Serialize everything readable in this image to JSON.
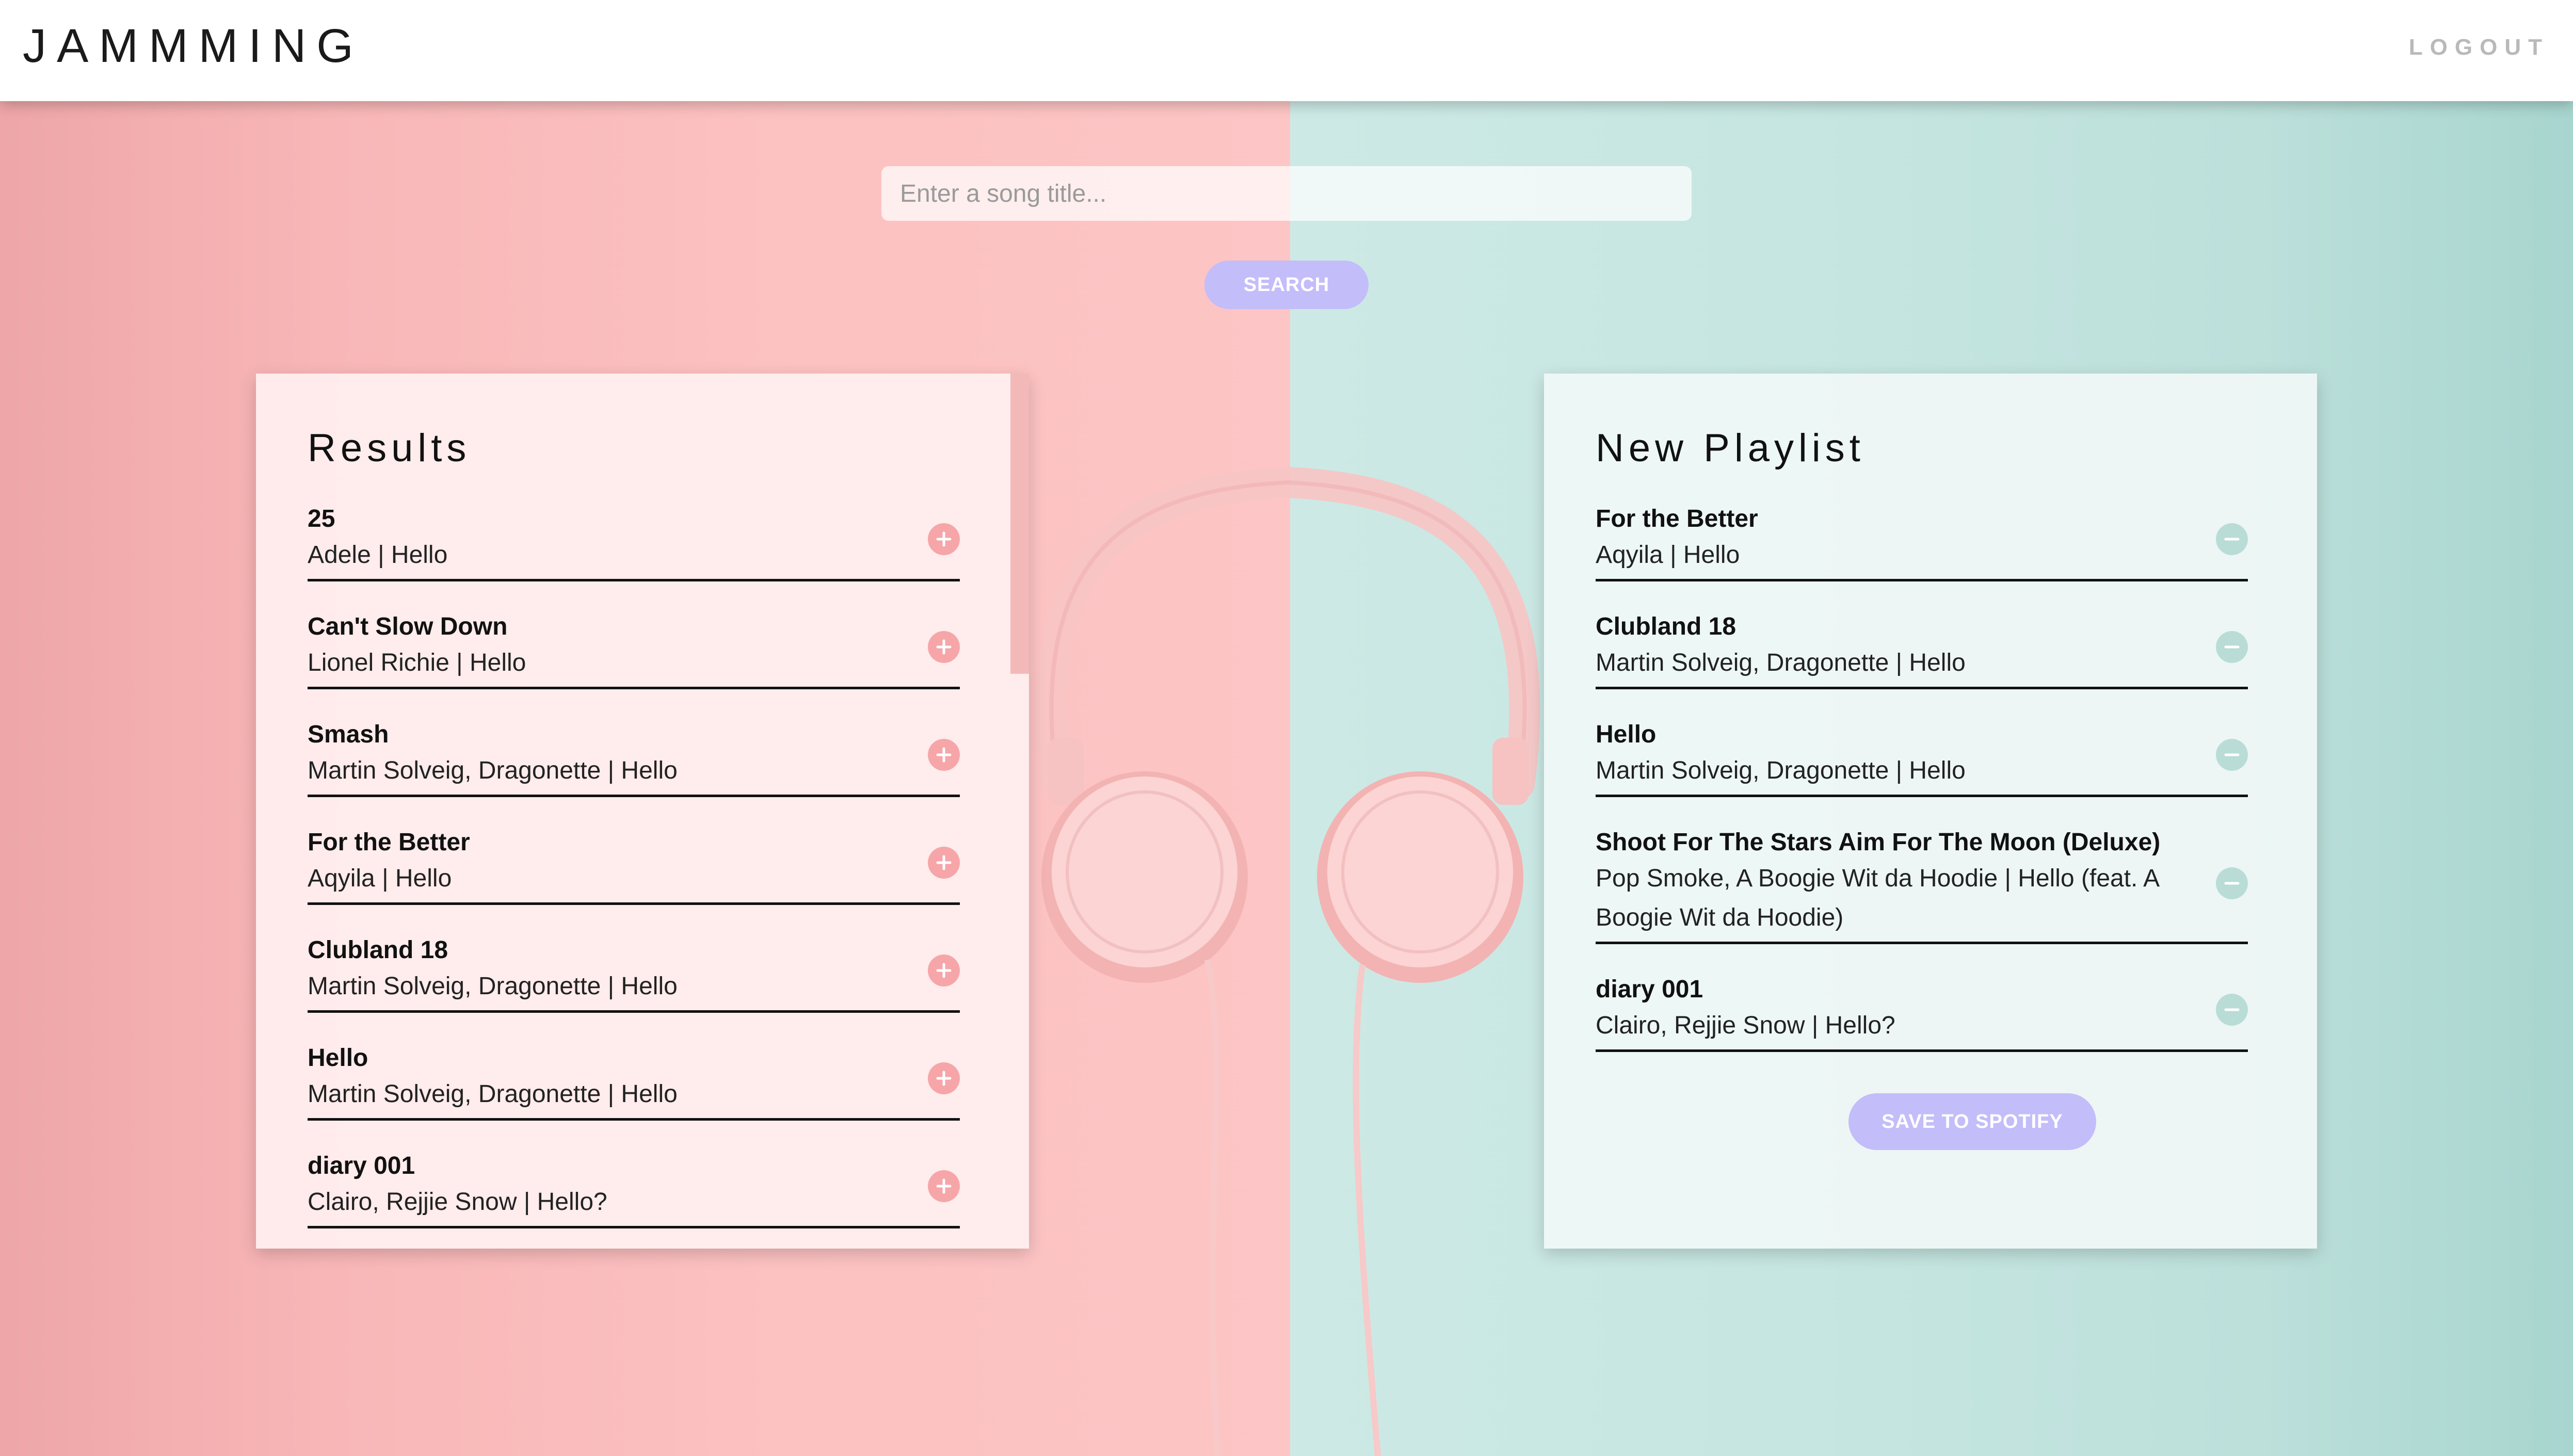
{
  "header": {
    "logo": "JAMMMING",
    "logout": "LOGOUT"
  },
  "search": {
    "placeholder": "Enter a song title...",
    "button": "SEARCH"
  },
  "results": {
    "title": "Results",
    "tracks": [
      {
        "name": "25",
        "info": "Adele | Hello"
      },
      {
        "name": "Can't Slow Down",
        "info": "Lionel Richie | Hello"
      },
      {
        "name": "Smash",
        "info": "Martin Solveig, Dragonette | Hello"
      },
      {
        "name": "For the Better",
        "info": "Aqyila | Hello"
      },
      {
        "name": "Clubland 18",
        "info": "Martin Solveig, Dragonette | Hello"
      },
      {
        "name": "Hello",
        "info": "Martin Solveig, Dragonette | Hello"
      },
      {
        "name": "diary 001",
        "info": "Clairo, Rejjie Snow | Hello?"
      }
    ]
  },
  "playlist": {
    "title": "New Playlist",
    "tracks": [
      {
        "name": "For the Better",
        "info": "Aqyila | Hello"
      },
      {
        "name": "Clubland 18",
        "info": "Martin Solveig, Dragonette | Hello"
      },
      {
        "name": "Hello",
        "info": "Martin Solveig, Dragonette | Hello"
      },
      {
        "name": "Shoot For The Stars Aim For The Moon (Deluxe)",
        "info": "Pop Smoke, A Boogie Wit da Hoodie | Hello (feat. A Boogie Wit da Hoodie)"
      },
      {
        "name": "diary 001",
        "info": "Clairo, Rejjie Snow | Hello?"
      }
    ],
    "save_button": "SAVE TO SPOTIFY"
  },
  "colors": {
    "accent_button": "#c3bdfa",
    "add_icon": "#f6a6a8",
    "remove_icon": "#b9ddd6",
    "background_left": "#fcc1c1",
    "background_right": "#c6e6e1"
  },
  "icons": {
    "add": "plus-icon",
    "remove": "minus-icon"
  }
}
